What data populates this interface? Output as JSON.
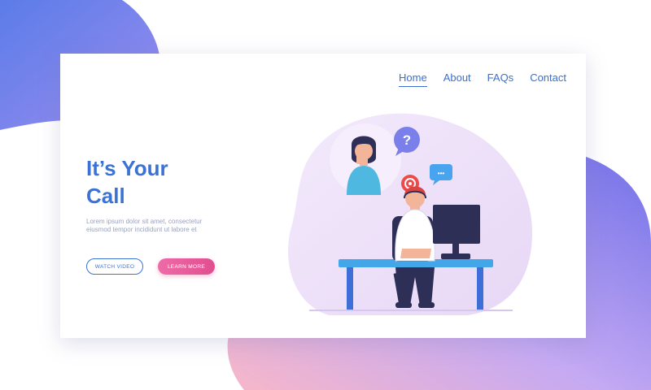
{
  "nav": {
    "items": [
      {
        "label": "Home",
        "active": true
      },
      {
        "label": "About",
        "active": false
      },
      {
        "label": "FAQs",
        "active": false
      },
      {
        "label": "Contact",
        "active": false
      }
    ]
  },
  "hero": {
    "headline": "It’s Your\nCall",
    "body": "Lorem ipsum dolor sit amet, consectetur eiusmod tempor incididunt ut labore et",
    "watch_label": "WATCH VIDEO",
    "learn_label": "LEARN MORE"
  },
  "illustration": {
    "question_mark": "?",
    "chat_dots": "•••"
  },
  "colors": {
    "accent_blue": "#3a73d4",
    "accent_pink": "#e85a9a",
    "blob_purple": "#7b86ee",
    "blob_lavender": "#e6d6f7"
  }
}
